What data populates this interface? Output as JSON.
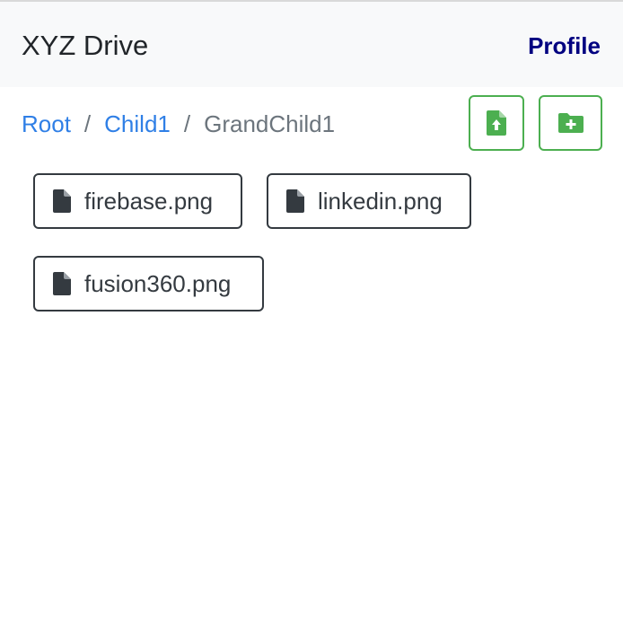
{
  "navbar": {
    "brand": "XYZ Drive",
    "profile_label": "Profile"
  },
  "breadcrumb": {
    "items": [
      "Root",
      "Child1"
    ],
    "separator": "/",
    "current": "GrandChild1"
  },
  "actions": {
    "upload_icon": "file-upload-icon",
    "add_folder_icon": "folder-plus-icon"
  },
  "files": [
    {
      "name": "firebase.png",
      "icon": "file-icon"
    },
    {
      "name": "linkedin.png",
      "icon": "file-icon"
    },
    {
      "name": "fusion360.png",
      "icon": "file-icon"
    }
  ],
  "colors": {
    "navbar_bg": "#f8f9fa",
    "brand_text": "#212529",
    "profile_text": "#000080",
    "link": "#2f7fe6",
    "muted": "#6c757d",
    "success": "#4caf50",
    "dark": "#343a40"
  }
}
